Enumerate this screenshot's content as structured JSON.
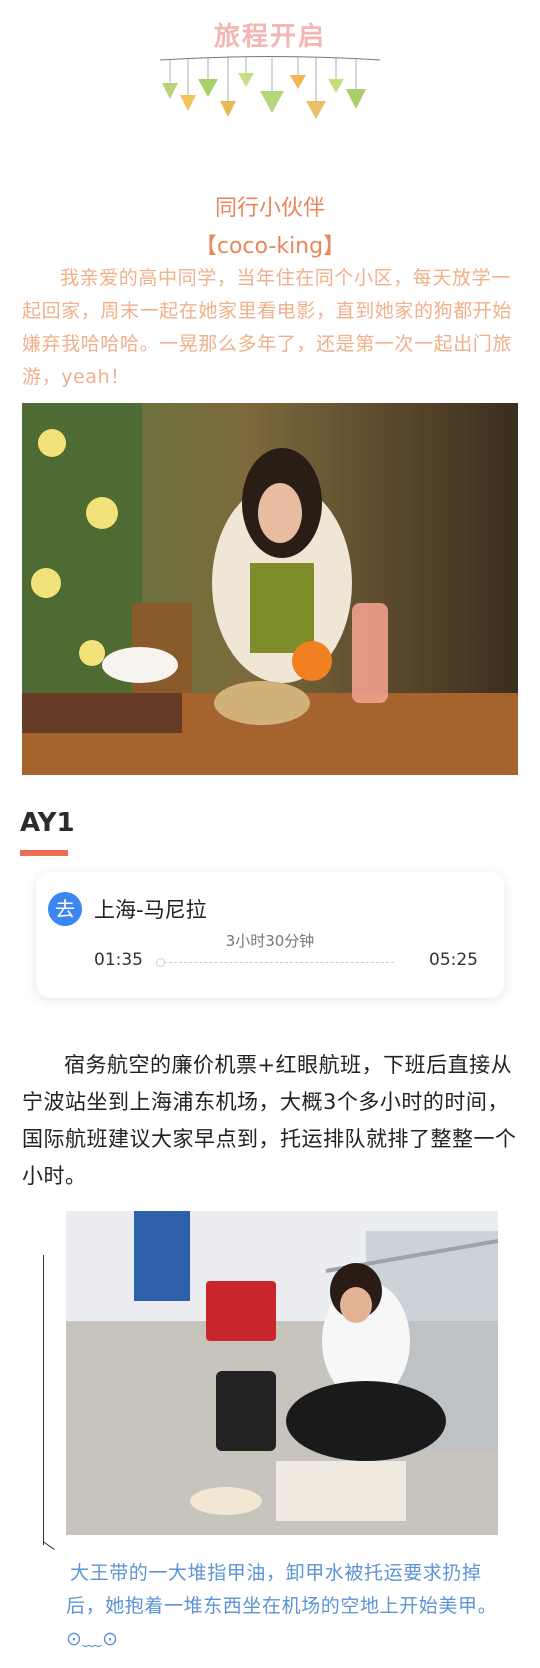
{
  "header": {
    "banner_title": "旅程开启"
  },
  "companion": {
    "section_title": "同行小伙伴",
    "name": "【coco-king】",
    "intro": "我亲爱的高中同学，当年住在同个小区，每天放学一起回家，周末一起在她家里看电影，直到她家的狗都开始嫌弃我哈哈哈。一晃那么多年了，还是第一次一起出门旅游，yeah！"
  },
  "day": {
    "label": "AY1"
  },
  "flight": {
    "badge": "去",
    "route": "上海-马尼拉",
    "duration": "3小时30分钟",
    "departure": "01:35",
    "arrival": "05:25"
  },
  "story": {
    "paragraph": "宿务航空的廉价机票+红眼航班，下班后直接从宁波站坐到上海浦东机场，大概3个多小时的时间，国际航班建议大家早点到，托运排队就排了整整一个小时。",
    "caption": "大王带的一大堆指甲油，卸甲水被托运要求扔掉后，她抱着一堆东西坐在机场的空地上开始美甲。⊙﹏⊙"
  },
  "colors": {
    "accent_orange": "#e9865a",
    "intro_text": "#f0b08a",
    "banner_pink": "#f4b5b3",
    "day_underline": "#ec6f54",
    "badge_blue": "#3c86f0",
    "caption_blue": "#5d94d6"
  },
  "icons": {
    "garland": "hanging-zongzi-garland-icon",
    "photo1": "restaurant-photo",
    "photo2": "airport-photo"
  }
}
